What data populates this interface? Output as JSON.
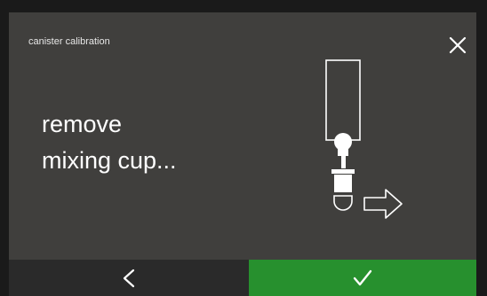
{
  "header": {
    "title": "canister calibration",
    "close_icon": "close-icon"
  },
  "main": {
    "message_lines": [
      "remove",
      "mixing cup..."
    ],
    "illustration": "canister-mixing-cup-removal"
  },
  "footer": {
    "back_icon": "chevron-left-icon",
    "confirm_icon": "checkmark-icon"
  },
  "colors": {
    "panel_background": "#403f3d",
    "back_button": "#2a2a2a",
    "confirm_button": "#27902e",
    "text": "#ffffff"
  }
}
